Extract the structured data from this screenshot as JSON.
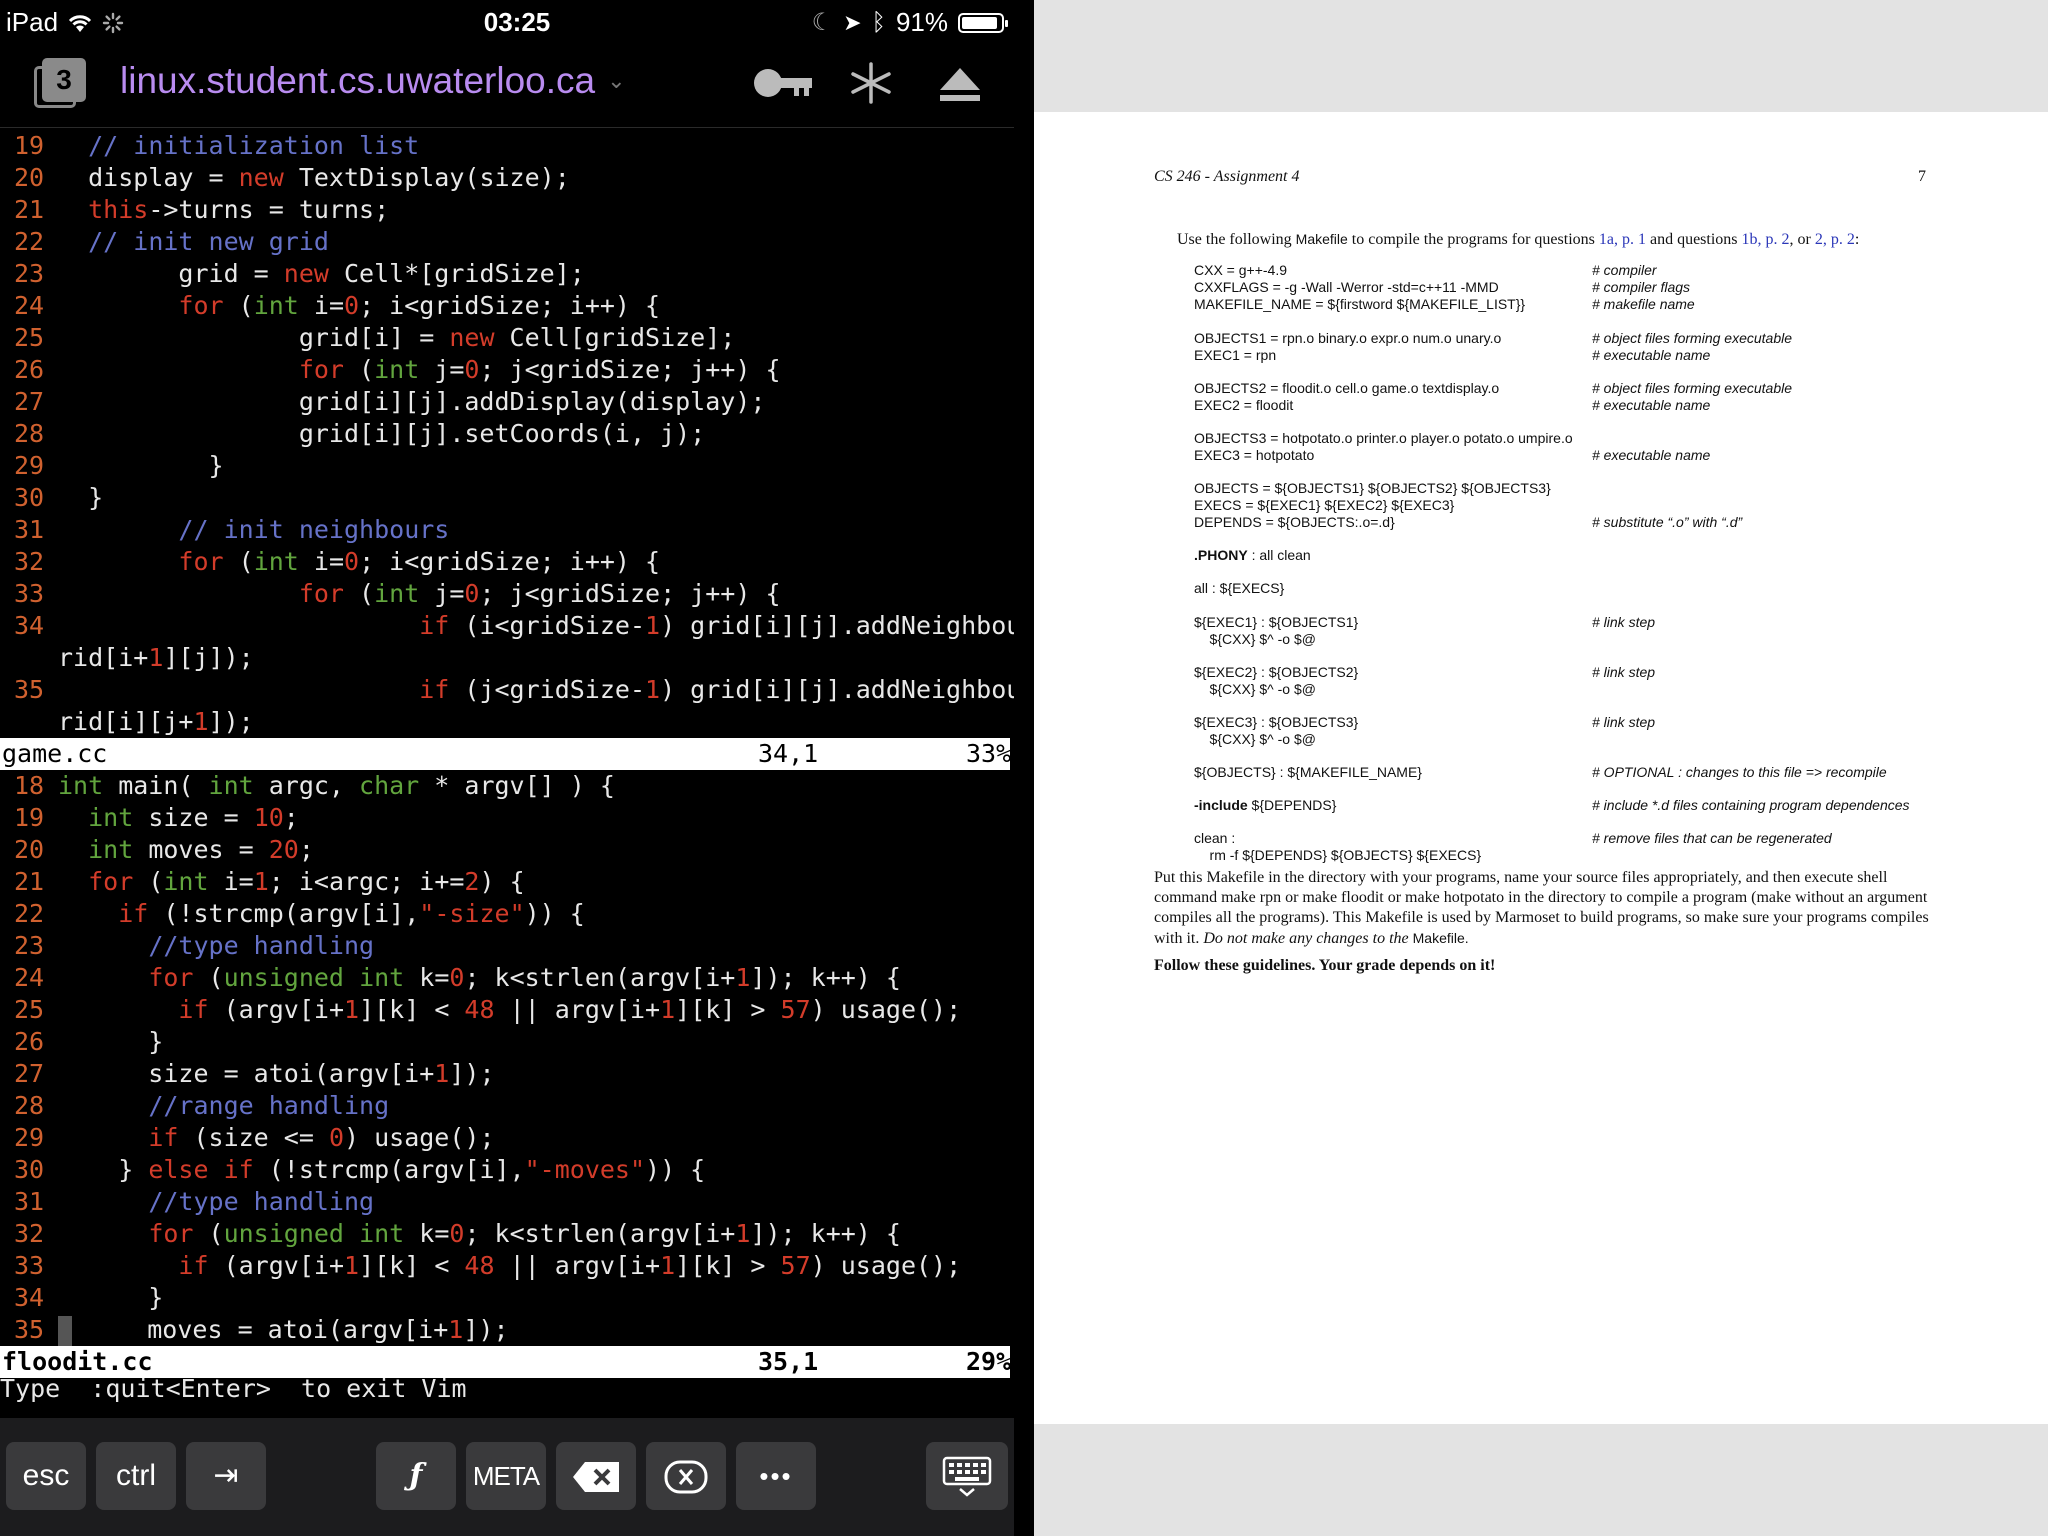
{
  "status_bar": {
    "device": "iPad",
    "time": "03:25",
    "battery": "91%",
    "battery_level": 0.91
  },
  "header": {
    "session_count": "3",
    "host": "linux.student.cs.uwaterloo.ca"
  },
  "editor": {
    "pane1": {
      "filename": "game.cc",
      "position": "34,1",
      "percent": "33%"
    },
    "pane2": {
      "filename": "floodit.cc",
      "position": "35,1",
      "percent": "29%"
    },
    "command_line": "Type  :quit<Enter>  to exit Vim"
  },
  "keyboard_bar": {
    "esc": "esc",
    "ctrl": "ctrl",
    "meta": "META",
    "more": "•••"
  },
  "pdf": {
    "header": "CS 246 - Assignment 4",
    "page_number": "7",
    "intro_a": "Use the following ",
    "intro_makefile": "Makefile",
    "intro_b": " to compile the programs for questions ",
    "ref1": "1a, p. 1",
    "intro_c": " and questions ",
    "ref2": "1b, p. 2",
    "intro_d": ", or ",
    "ref3": "2, p. 2",
    "intro_e": ":",
    "makefile_rows": [
      {
        "code": "CXX = g++-4.9",
        "comment": "# compiler"
      },
      {
        "code": "CXXFLAGS = -g -Wall -Werror -std=c++11 -MMD",
        "comment": "# compiler flags"
      },
      {
        "code": "MAKEFILE_NAME = ${firstword ${MAKEFILE_LIST}}",
        "comment": "# makefile name"
      },
      {
        "code": "OBJECTS1 = rpn.o binary.o expr.o num.o unary.o",
        "comment": "# object files forming executable"
      },
      {
        "code": "EXEC1 = rpn",
        "comment": "# executable name"
      },
      {
        "code": "OBJECTS2 = floodit.o cell.o game.o textdisplay.o",
        "comment": "# object files forming executable"
      },
      {
        "code": "EXEC2 = floodit",
        "comment": "# executable name"
      },
      {
        "code": "OBJECTS3 = hotpotato.o printer.o player.o potato.o umpire.o",
        "comment": ""
      },
      {
        "code": "EXEC3 = hotpotato",
        "comment": "# executable name"
      },
      {
        "code": "OBJECTS = ${OBJECTS1} ${OBJECTS2} ${OBJECTS3}",
        "comment": ""
      },
      {
        "code": "EXECS = ${EXEC1} ${EXEC2} ${EXEC3}",
        "comment": ""
      },
      {
        "code": "DEPENDS = ${OBJECTS:.o=.d}",
        "comment": "# substitute “.o” with “.d”"
      },
      {
        "code": ".PHONY : all clean",
        "comment": ""
      },
      {
        "code": "all : ${EXECS}",
        "comment": ""
      },
      {
        "code": "${EXEC1} : ${OBJECTS1}",
        "comment": "# link step"
      },
      {
        "code": "    ${CXX} $^ -o $@",
        "comment": ""
      },
      {
        "code": "${EXEC2} : ${OBJECTS2}",
        "comment": "# link step"
      },
      {
        "code": "    ${CXX} $^ -o $@",
        "comment": ""
      },
      {
        "code": "${EXEC3} : ${OBJECTS3}",
        "comment": "# link step"
      },
      {
        "code": "    ${CXX} $^ -o $@",
        "comment": ""
      },
      {
        "code": "${OBJECTS} : ${MAKEFILE_NAME}",
        "comment": "# OPTIONAL : changes to this file => recompile"
      },
      {
        "code": "-include ${DEPENDS}",
        "comment": "# include *.d files containing program dependences"
      },
      {
        "code": "clean :",
        "comment": "# remove files that can be regenerated"
      },
      {
        "code": "    rm -f ${DEPENDS} ${OBJECTS} ${EXECS}",
        "comment": ""
      }
    ],
    "para": "Put this Makefile in the directory with your programs, name your source files appropriately, and then execute shell command make rpn or make floodit or make hotpotato in the directory to compile a program (make without an argument compiles all the programs). This Makefile is used by Marmoset to build programs, so make sure your programs compiles with it.",
    "para_em": "Do not make any changes to the",
    "para_end": "Makefile.",
    "bold_line": "Follow these guidelines. Your grade depends on it!"
  }
}
